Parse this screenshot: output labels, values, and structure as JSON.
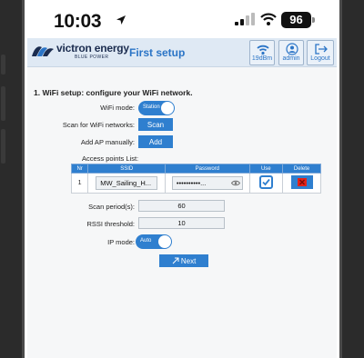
{
  "status_bar": {
    "time": "10:03",
    "battery": "96"
  },
  "header": {
    "brand": "victron energy",
    "brand_sub": "BLUE POWER",
    "title": "First setup",
    "wifi_label": "19dBm",
    "admin_label": "admin",
    "logout_label": "Logout"
  },
  "wifi_setup": {
    "section_title": "1. WiFi setup: configure your WiFi network.",
    "wifi_mode_label": "WiFi mode:",
    "wifi_mode_value": "Station",
    "scan_label": "Scan for WiFi networks:",
    "scan_button": "Scan",
    "add_ap_label": "Add AP manually:",
    "add_button": "Add",
    "ap_list_caption": "Access points List:",
    "ap_table": {
      "headers": [
        "Nr",
        "SSID",
        "Password",
        "Use",
        "Delete"
      ],
      "rows": [
        {
          "nr": "1",
          "ssid": "MW_Sailing_H...",
          "password": "••••••••••...",
          "use": true
        }
      ]
    },
    "scan_period_label": "Scan period(s):",
    "scan_period_value": "60",
    "rssi_label": "RSSI threshold:",
    "rssi_value": "10",
    "ip_mode_label": "IP mode:",
    "ip_mode_value": "Auto",
    "next_button": "Next"
  },
  "colors": {
    "accent": "#2f7fcf",
    "header_bg": "#dfe9f4",
    "delete_red": "#e2231a"
  }
}
